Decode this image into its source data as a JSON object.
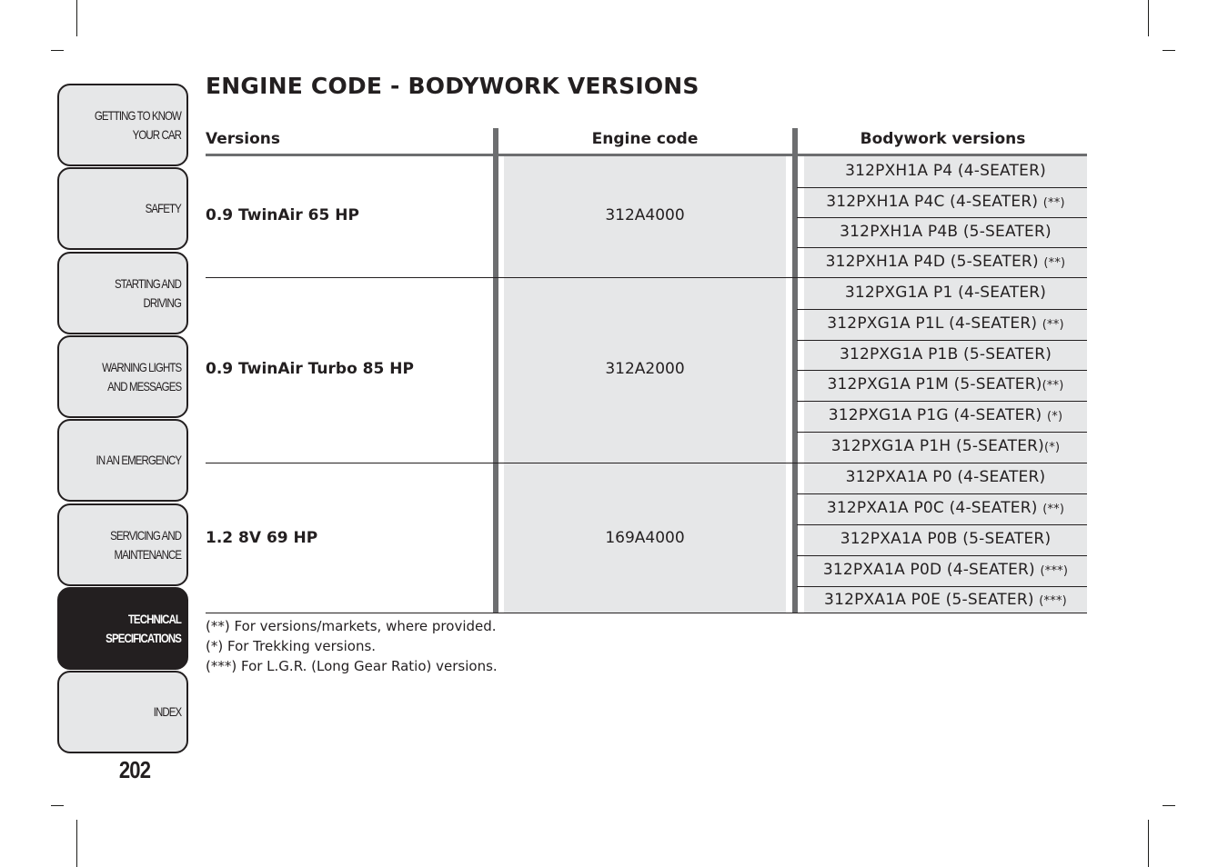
{
  "sidebar": {
    "tabs": [
      {
        "label": "GETTING TO KNOW\nYOUR CAR",
        "active": false
      },
      {
        "label": "SAFETY",
        "active": false
      },
      {
        "label": "STARTING AND\nDRIVING",
        "active": false
      },
      {
        "label": "WARNING LIGHTS\nAND MESSAGES",
        "active": false
      },
      {
        "label": "IN AN EMERGENCY",
        "active": false
      },
      {
        "label": "SERVICING AND\nMAINTENANCE",
        "active": false
      },
      {
        "label": "TECHNICAL\nSPECIFICATIONS",
        "active": true
      },
      {
        "label": "INDEX",
        "active": false
      }
    ],
    "page_number": "202"
  },
  "page": {
    "title": "ENGINE CODE - BODYWORK VERSIONS"
  },
  "table": {
    "headers": {
      "versions": "Versions",
      "engine_code": "Engine code",
      "bodywork": "Bodywork versions"
    },
    "groups": [
      {
        "version": "0.9 TwinAir 65 HP",
        "engine_code": "312A4000",
        "bodywork": [
          {
            "text": "312PXH1A P4 (4-SEATER)",
            "note": ""
          },
          {
            "text": "312PXH1A P4C (4-SEATER) ",
            "note": "(**)"
          },
          {
            "text": "312PXH1A P4B (5-SEATER)",
            "note": ""
          },
          {
            "text": "312PXH1A P4D (5-SEATER) ",
            "note": "(**)"
          }
        ]
      },
      {
        "version": "0.9 TwinAir Turbo 85 HP",
        "engine_code": "312A2000",
        "bodywork": [
          {
            "text": "312PXG1A P1 (4-SEATER)",
            "note": ""
          },
          {
            "text": "312PXG1A P1L (4-SEATER) ",
            "note": "(**)"
          },
          {
            "text": "312PXG1A P1B (5-SEATER)",
            "note": ""
          },
          {
            "text": "312PXG1A P1M (5-SEATER)",
            "note": "(**)"
          },
          {
            "text": "312PXG1A P1G (4-SEATER) ",
            "note": "(*)"
          },
          {
            "text": "312PXG1A P1H (5-SEATER)",
            "note": "(*)"
          }
        ]
      },
      {
        "version": "1.2 8V 69 HP",
        "engine_code": "169A4000",
        "bodywork": [
          {
            "text": "312PXA1A P0 (4-SEATER)",
            "note": ""
          },
          {
            "text": "312PXA1A P0C (4-SEATER) ",
            "note": "(**)"
          },
          {
            "text": "312PXA1A P0B (5-SEATER)",
            "note": ""
          },
          {
            "text": "312PXA1A P0D (4-SEATER) ",
            "note": "(***)"
          },
          {
            "text": "312PXA1A P0E (5-SEATER) ",
            "note": "(***)"
          }
        ]
      }
    ]
  },
  "footnotes": [
    "(**) For versions/markets, where provided.",
    "(*) For Trekking versions.",
    "(***) For L.G.R. (Long Gear Ratio) versions."
  ]
}
